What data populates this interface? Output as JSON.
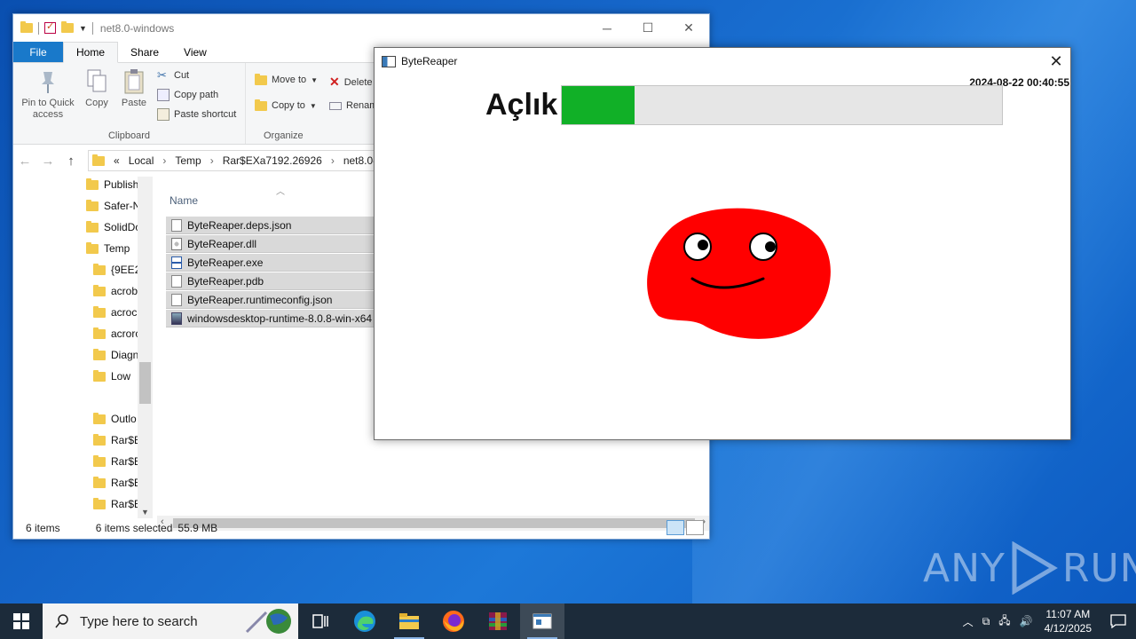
{
  "explorer": {
    "title": "net8.0-windows",
    "tabs": [
      "File",
      "Home",
      "Share",
      "View"
    ],
    "ribbon": {
      "clipboard": {
        "group_name": "Clipboard",
        "pin_label": "Pin to Quick access",
        "copy_label": "Copy",
        "paste_label": "Paste",
        "cut_label": "Cut",
        "copy_path_label": "Copy path",
        "paste_shortcut_label": "Paste shortcut"
      },
      "organize": {
        "group_name": "Organize",
        "move_to_label": "Move to",
        "copy_to_label": "Copy to",
        "delete_label": "Delete",
        "rename_label": "Renam"
      }
    },
    "address": {
      "overflow": "«",
      "crumbs": [
        "Local",
        "Temp",
        "Rar$EXa7192.26926",
        "net8.0-"
      ]
    },
    "nav_items": [
      "Publish",
      "Safer-N",
      "SolidDo",
      "Temp",
      "{9EE2!",
      "acrob",
      "acroc",
      "acrorc",
      "Diagn",
      "Low",
      "Outlo",
      "Rar$E",
      "Rar$E",
      "Rar$E",
      "Rar$E"
    ],
    "column_name": "Name",
    "files": [
      {
        "name": "ByteReaper.deps.json",
        "icon": "json-file-icon"
      },
      {
        "name": "ByteReaper.dll",
        "icon": "dll-file-icon"
      },
      {
        "name": "ByteReaper.exe",
        "icon": "exe-file-icon"
      },
      {
        "name": "ByteReaper.pdb",
        "icon": "pdb-file-icon"
      },
      {
        "name": "ByteReaper.runtimeconfig.json",
        "icon": "json-file-icon"
      },
      {
        "name": "windowsdesktop-runtime-8.0.8-win-x64",
        "icon": "installer-icon"
      }
    ],
    "status": {
      "items": "6 items",
      "selected": "6 items selected",
      "size": "55.9 MB"
    }
  },
  "app": {
    "title": "ByteReaper",
    "timestamp": "2024-08-22 00:40:55",
    "hunger_label": "Açlık",
    "hunger_level_percent": 16.5,
    "hunger_color": "#11b027",
    "creature_color": "#ff0000"
  },
  "taskbar": {
    "search_placeholder": "Type here to search",
    "pinned": [
      "task-view-icon",
      "edge-icon",
      "file-explorer-icon",
      "firefox-icon",
      "winrar-icon",
      "bytereaper-icon"
    ],
    "time": "11:07 AM",
    "date": "4/12/2025"
  },
  "watermark": {
    "left_text": "ANY",
    "right_text": "RUN"
  }
}
